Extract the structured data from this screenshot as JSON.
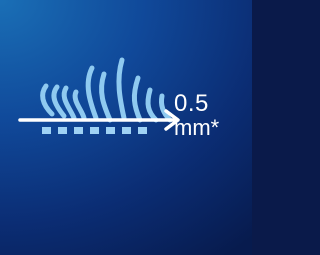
{
  "measurement": {
    "value": "0.5",
    "unit": "mm*"
  },
  "icons": {
    "hair": "hair-strands-icon",
    "arrow": "length-arrow-icon",
    "skin": "skin-surface-icon"
  },
  "colors": {
    "background_light": "#1a6fb6",
    "background_dark": "#071b4e",
    "hair": "#8fcaf0",
    "skin_blocks": "#9fd2f4",
    "arrow": "#ffffff",
    "text": "#ffffff"
  }
}
